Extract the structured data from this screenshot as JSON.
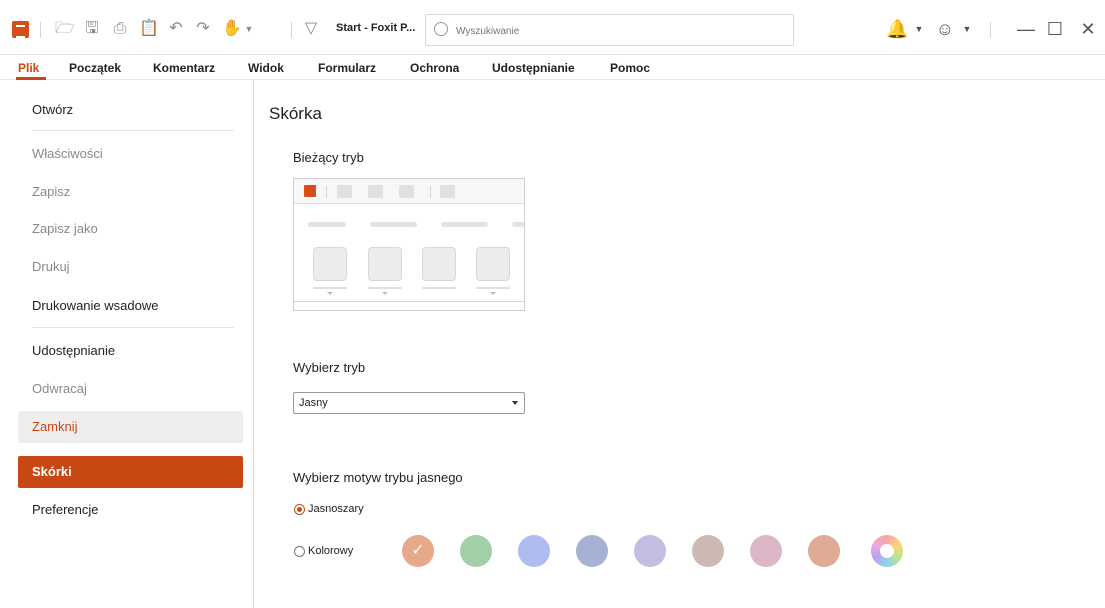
{
  "titlebar": {
    "doc_title": "Start - Foxit P...",
    "search_placeholder": "Wyszukiwanie",
    "icons": [
      "open-icon",
      "save-icon",
      "print-icon",
      "paste-icon",
      "undo-icon",
      "redo-icon",
      "hand-tool-icon",
      "customize-quick-access-icon",
      "bell-icon",
      "account-icon",
      "minimize-icon",
      "maximize-icon",
      "close-icon"
    ]
  },
  "menubar": {
    "items": [
      "Plik",
      "Początek",
      "Komentarz",
      "Widok",
      "Formularz",
      "Ochrona",
      "Udostępnianie",
      "Pomoc"
    ],
    "active": "Plik",
    "accent_color": "#c74812"
  },
  "sidebar": {
    "items": [
      {
        "label": "Otwórz",
        "state": "normal"
      },
      {
        "label": "Właściwości",
        "state": "disabled"
      },
      {
        "label": "Zapisz",
        "state": "disabled"
      },
      {
        "label": "Zapisz jako",
        "state": "disabled"
      },
      {
        "label": "Drukuj",
        "state": "disabled"
      },
      {
        "label": "Drukowanie wsadowe",
        "state": "normal"
      },
      {
        "label": "Udostępnianie",
        "state": "normal"
      },
      {
        "label": "Odwracaj",
        "state": "disabled"
      },
      {
        "label": "Zamknij",
        "state": "hover"
      },
      {
        "label": "Skórki",
        "state": "selected"
      },
      {
        "label": "Preferencje",
        "state": "normal"
      }
    ]
  },
  "content": {
    "heading": "Skórka",
    "current_mode_label": "Bieżący tryb",
    "choose_mode_label": "Wybierz tryb",
    "mode_select_value": "Jasny",
    "choose_theme_label": "Wybierz motyw trybu jasnego",
    "radio_light_gray": "Jasnoszary",
    "radio_light_gray_checked": true,
    "radio_colorful": "Kolorowy",
    "radio_colorful_checked": false,
    "swatch_colors": [
      "#e8a98a",
      "#a3cfa6",
      "#aebcf0",
      "#a6b1d3",
      "#c4bde3",
      "#cdb9b1",
      "#ddb7c8",
      "#e0ab95"
    ],
    "selected_swatch": 0,
    "custom_swatch": "multicolor-icon"
  }
}
